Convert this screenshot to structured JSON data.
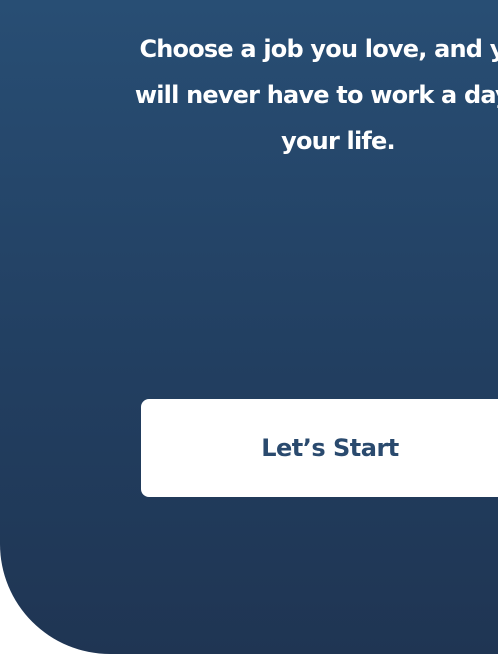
{
  "welcome": {
    "quote": "Choose a job you love, and you\nwill never have to work a day in\nyour life.",
    "start_button_label": "Let’s Start"
  },
  "colors": {
    "background_top": "#284e74",
    "background_bottom": "#1f3553",
    "button_background": "#ffffff",
    "button_text": "#2a4a6e",
    "quote_text": "#ffffff"
  }
}
